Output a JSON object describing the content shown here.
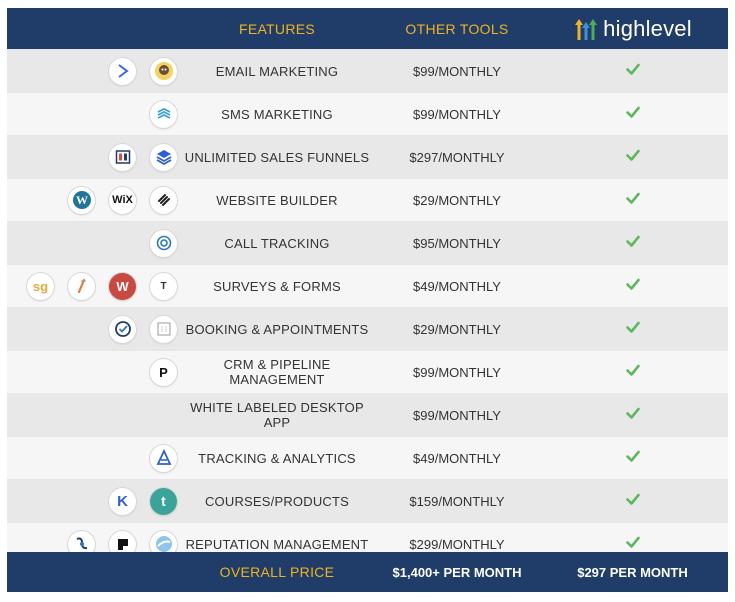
{
  "header": {
    "features": "FEATURES",
    "other_tools": "OTHER TOOLS",
    "brand": "highlevel"
  },
  "rows": [
    {
      "feature": "EMAIL MARKETING",
      "price": "$99/MONTHLY",
      "icons": [
        "activecampaign-icon",
        "mailchimp-icon"
      ]
    },
    {
      "feature": "SMS MARKETING",
      "price": "$99/MONTHLY",
      "icons": [
        "sms-layers-icon"
      ]
    },
    {
      "feature": "UNLIMITED SALES FUNNELS",
      "price": "$297/MONTHLY",
      "icons": [
        "clickfunnels-icon",
        "stack-icon"
      ]
    },
    {
      "feature": "WEBSITE BUILDER",
      "price": "$29/MONTHLY",
      "icons": [
        "wordpress-icon",
        "wix-icon",
        "squarespace-icon"
      ]
    },
    {
      "feature": "CALL TRACKING",
      "price": "$95/MONTHLY",
      "icons": [
        "calltracking-icon"
      ]
    },
    {
      "feature": "SURVEYS & FORMS",
      "price": "$49/MONTHLY",
      "icons": [
        "surveygizmo-icon",
        "formstack-icon",
        "wufoo-icon",
        "typeform-icon"
      ]
    },
    {
      "feature": "BOOKING & APPOINTMENTS",
      "price": "$29/MONTHLY",
      "icons": [
        "calendly-icon",
        "acuity-icon"
      ]
    },
    {
      "feature": "CRM & PIPELINE MANAGEMENT",
      "price": "$99/MONTHLY",
      "icons": [
        "pipedrive-icon"
      ]
    },
    {
      "feature": "WHITE LABELED DESKTOP APP",
      "price": "$99/MONTHLY",
      "icons": []
    },
    {
      "feature": "TRACKING & ANALYTICS",
      "price": "$49/MONTHLY",
      "icons": [
        "analytics-icon"
      ]
    },
    {
      "feature": "COURSES/PRODUCTS",
      "price": "$159/MONTHLY",
      "icons": [
        "kajabi-icon",
        "teachable-icon"
      ]
    },
    {
      "feature": "REPUTATION MANAGEMENT",
      "price": "$299/MONTHLY",
      "icons": [
        "birdeye-icon",
        "podium-icon",
        "grade-us-icon"
      ]
    }
  ],
  "icon_text": {
    "wix-icon": "WiX",
    "surveygizmo-icon": "sg",
    "wufoo-icon": "W",
    "typeform-icon": "T",
    "pipedrive-icon": "P",
    "teachable-icon": "t",
    "kajabi-icon": "K"
  },
  "footer": {
    "label": "OVERALL PRICE",
    "other_total": "$1,400+ PER MONTH",
    "highlevel_total": "$297 PER MONTH"
  },
  "colors": {
    "header_bg": "#1f3d68",
    "accent": "#f2b31c",
    "check": "#5cb85c"
  }
}
